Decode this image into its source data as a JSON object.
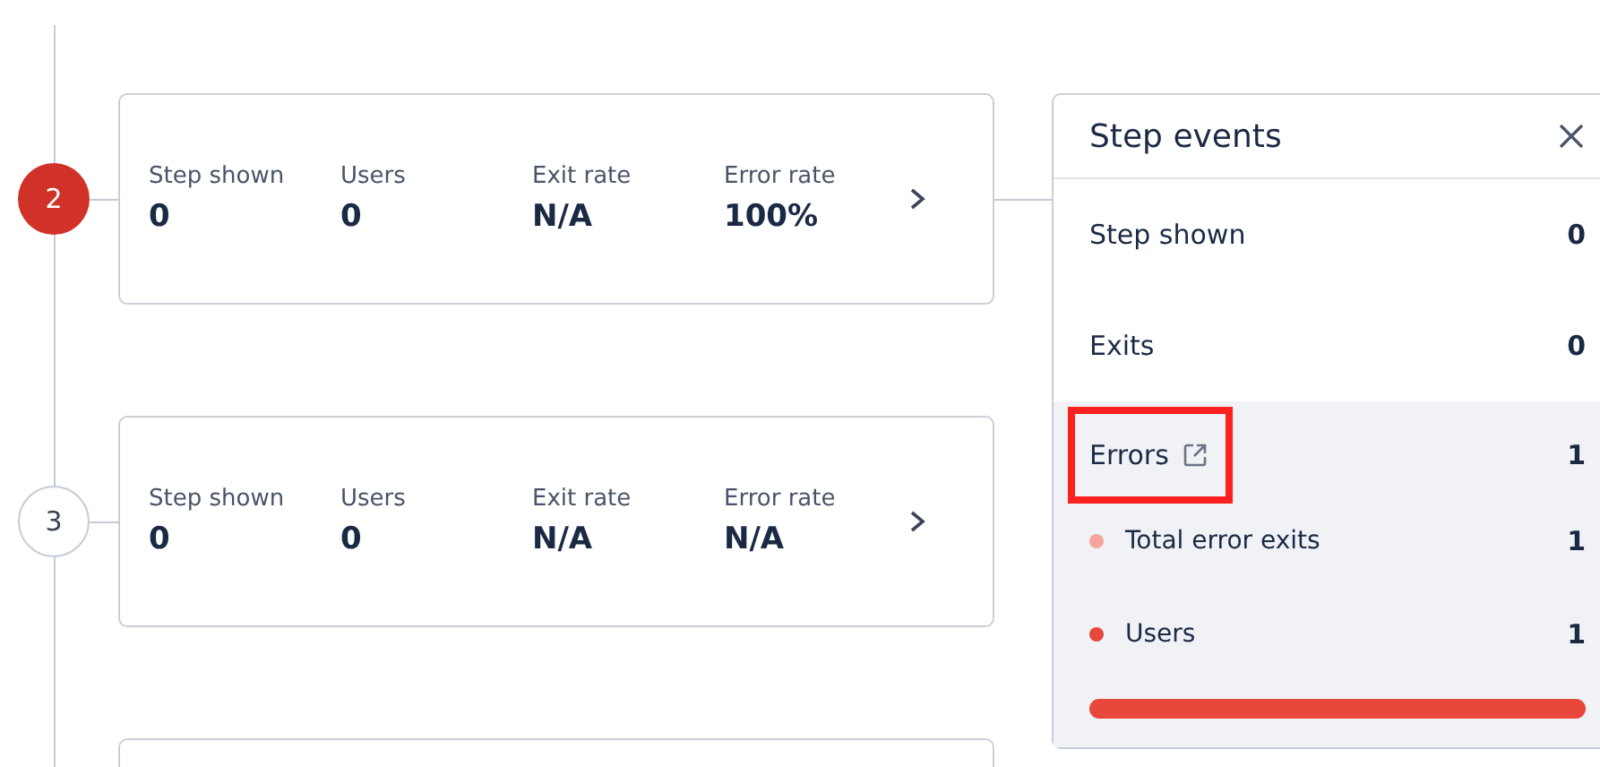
{
  "steps": [
    {
      "number": "2",
      "error": true,
      "expanded": true,
      "metrics": [
        {
          "label": "Step shown",
          "value": "0"
        },
        {
          "label": "Users",
          "value": "0"
        },
        {
          "label": "Exit rate",
          "value": "N/A"
        },
        {
          "label": "Error rate",
          "value": "100%"
        }
      ]
    },
    {
      "number": "3",
      "error": false,
      "expanded": false,
      "metrics": [
        {
          "label": "Step shown",
          "value": "0"
        },
        {
          "label": "Users",
          "value": "0"
        },
        {
          "label": "Exit rate",
          "value": "N/A"
        },
        {
          "label": "Error rate",
          "value": "N/A"
        }
      ]
    }
  ],
  "next_step_partly_visible": true,
  "panel": {
    "title": "Step events",
    "rows": [
      {
        "label": "Step shown",
        "value": "0"
      },
      {
        "label": "Exits",
        "value": "0"
      }
    ],
    "errors": {
      "label": "Errors",
      "value": "1",
      "highlighted": true,
      "items": [
        {
          "label": "Total error exits",
          "value": "1",
          "color": "#f6a59c"
        },
        {
          "label": "Users",
          "value": "1",
          "color": "#e8473b"
        }
      ],
      "level": 1
    }
  }
}
